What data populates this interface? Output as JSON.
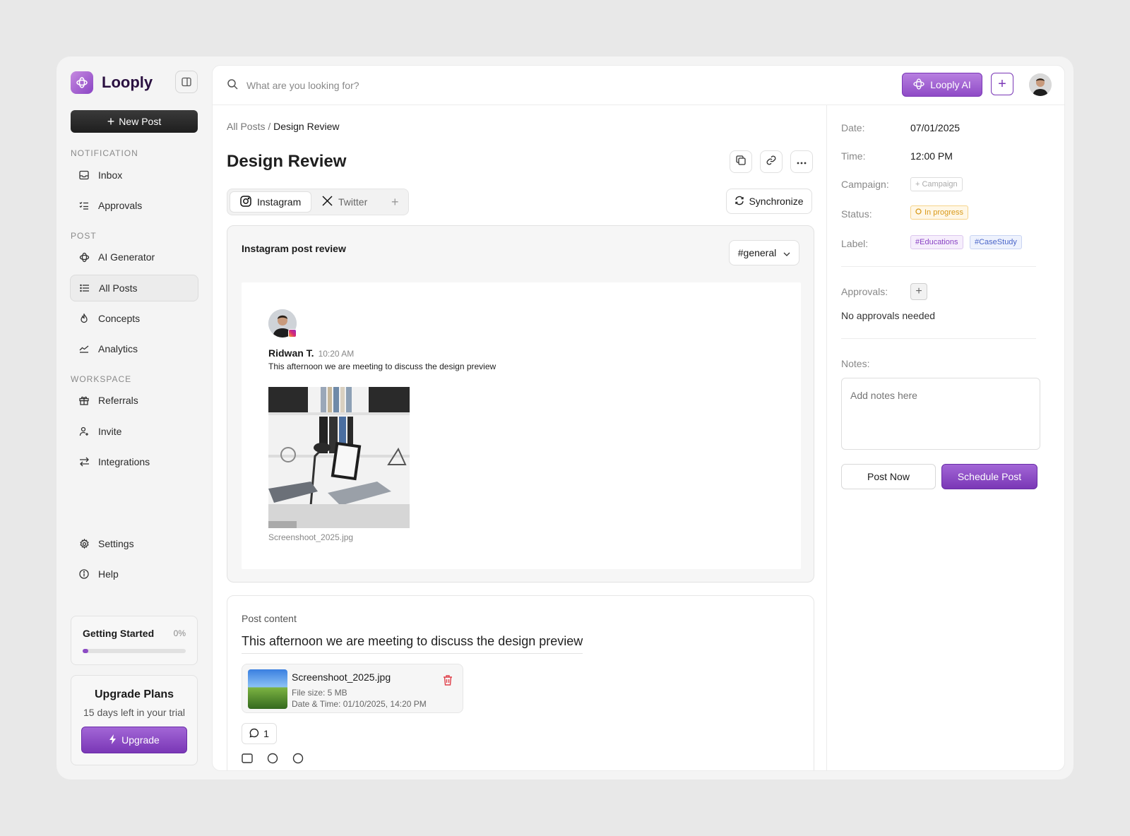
{
  "app": {
    "name": "Looply"
  },
  "sidebar": {
    "new_post_label": "New Post",
    "section_notification": "NOTIFICATION",
    "section_post": "POST",
    "section_workspace": "WORKSPACE",
    "items": [
      {
        "label": "Inbox",
        "icon": "inbox-icon"
      },
      {
        "label": "Approvals",
        "icon": "checklist-icon"
      },
      {
        "label": "AI Generator",
        "icon": "sparkle-icon"
      },
      {
        "label": "All Posts",
        "icon": "list-icon",
        "active": true
      },
      {
        "label": "Concepts",
        "icon": "flame-icon"
      },
      {
        "label": "Analytics",
        "icon": "chart-icon"
      },
      {
        "label": "Referrals",
        "icon": "gift-icon"
      },
      {
        "label": "Invite",
        "icon": "user-plus-icon"
      },
      {
        "label": "Integrations",
        "icon": "arrows-icon"
      },
      {
        "label": "Settings",
        "icon": "gear-icon"
      },
      {
        "label": "Help",
        "icon": "info-icon"
      }
    ],
    "getting_started": {
      "title": "Getting Started",
      "percent_label": "0%",
      "progress": 0
    },
    "upgrade": {
      "title": "Upgrade Plans",
      "subtitle": "15 days left in your trial",
      "button": "Upgrade"
    }
  },
  "topbar": {
    "search_placeholder": "What are you looking for?",
    "ai_button": "Looply AI"
  },
  "main": {
    "breadcrumb_parent": "All Posts",
    "breadcrumb_sep": " / ",
    "breadcrumb_current": "Design Review",
    "title": "Design Review",
    "tabs": [
      {
        "label": "Instagram",
        "active": true
      },
      {
        "label": "Twitter",
        "active": false
      }
    ],
    "sync_label": "Synchronize",
    "review": {
      "title": "Instagram post review",
      "tag": "#general",
      "author": "Ridwan T.",
      "time": "10:20 AM",
      "text": "This afternoon we are meeting to discuss the design preview",
      "image_caption": "Screenshoot_2025.jpg"
    },
    "post_content": {
      "label": "Post content",
      "text": "This afternoon we are meeting to discuss the design preview",
      "file": {
        "name": "Screenshoot_2025.jpg",
        "size": "File size: 5 MB",
        "datetime": "Date & Time: 01/10/2025, 14:20 PM"
      },
      "comment_count": "1"
    }
  },
  "details": {
    "date_label": "Date:",
    "date_value": "07/01/2025",
    "time_label": "Time:",
    "time_value": "12:00 PM",
    "campaign_label": "Campaign:",
    "campaign_value": "+ Campaign",
    "status_label": "Status:",
    "status_value": "In progress",
    "label_label": "Label:",
    "labels": [
      "#Educations",
      "#CaseStudy"
    ],
    "approvals_label": "Approvals:",
    "approvals_value": "No approvals needed",
    "notes_label": "Notes:",
    "notes_placeholder": "Add notes here",
    "post_now": "Post Now",
    "schedule": "Schedule Post"
  },
  "colors": {
    "accent": "#8c4bc4",
    "status": "#d99a1b",
    "delete": "#e0404a"
  }
}
